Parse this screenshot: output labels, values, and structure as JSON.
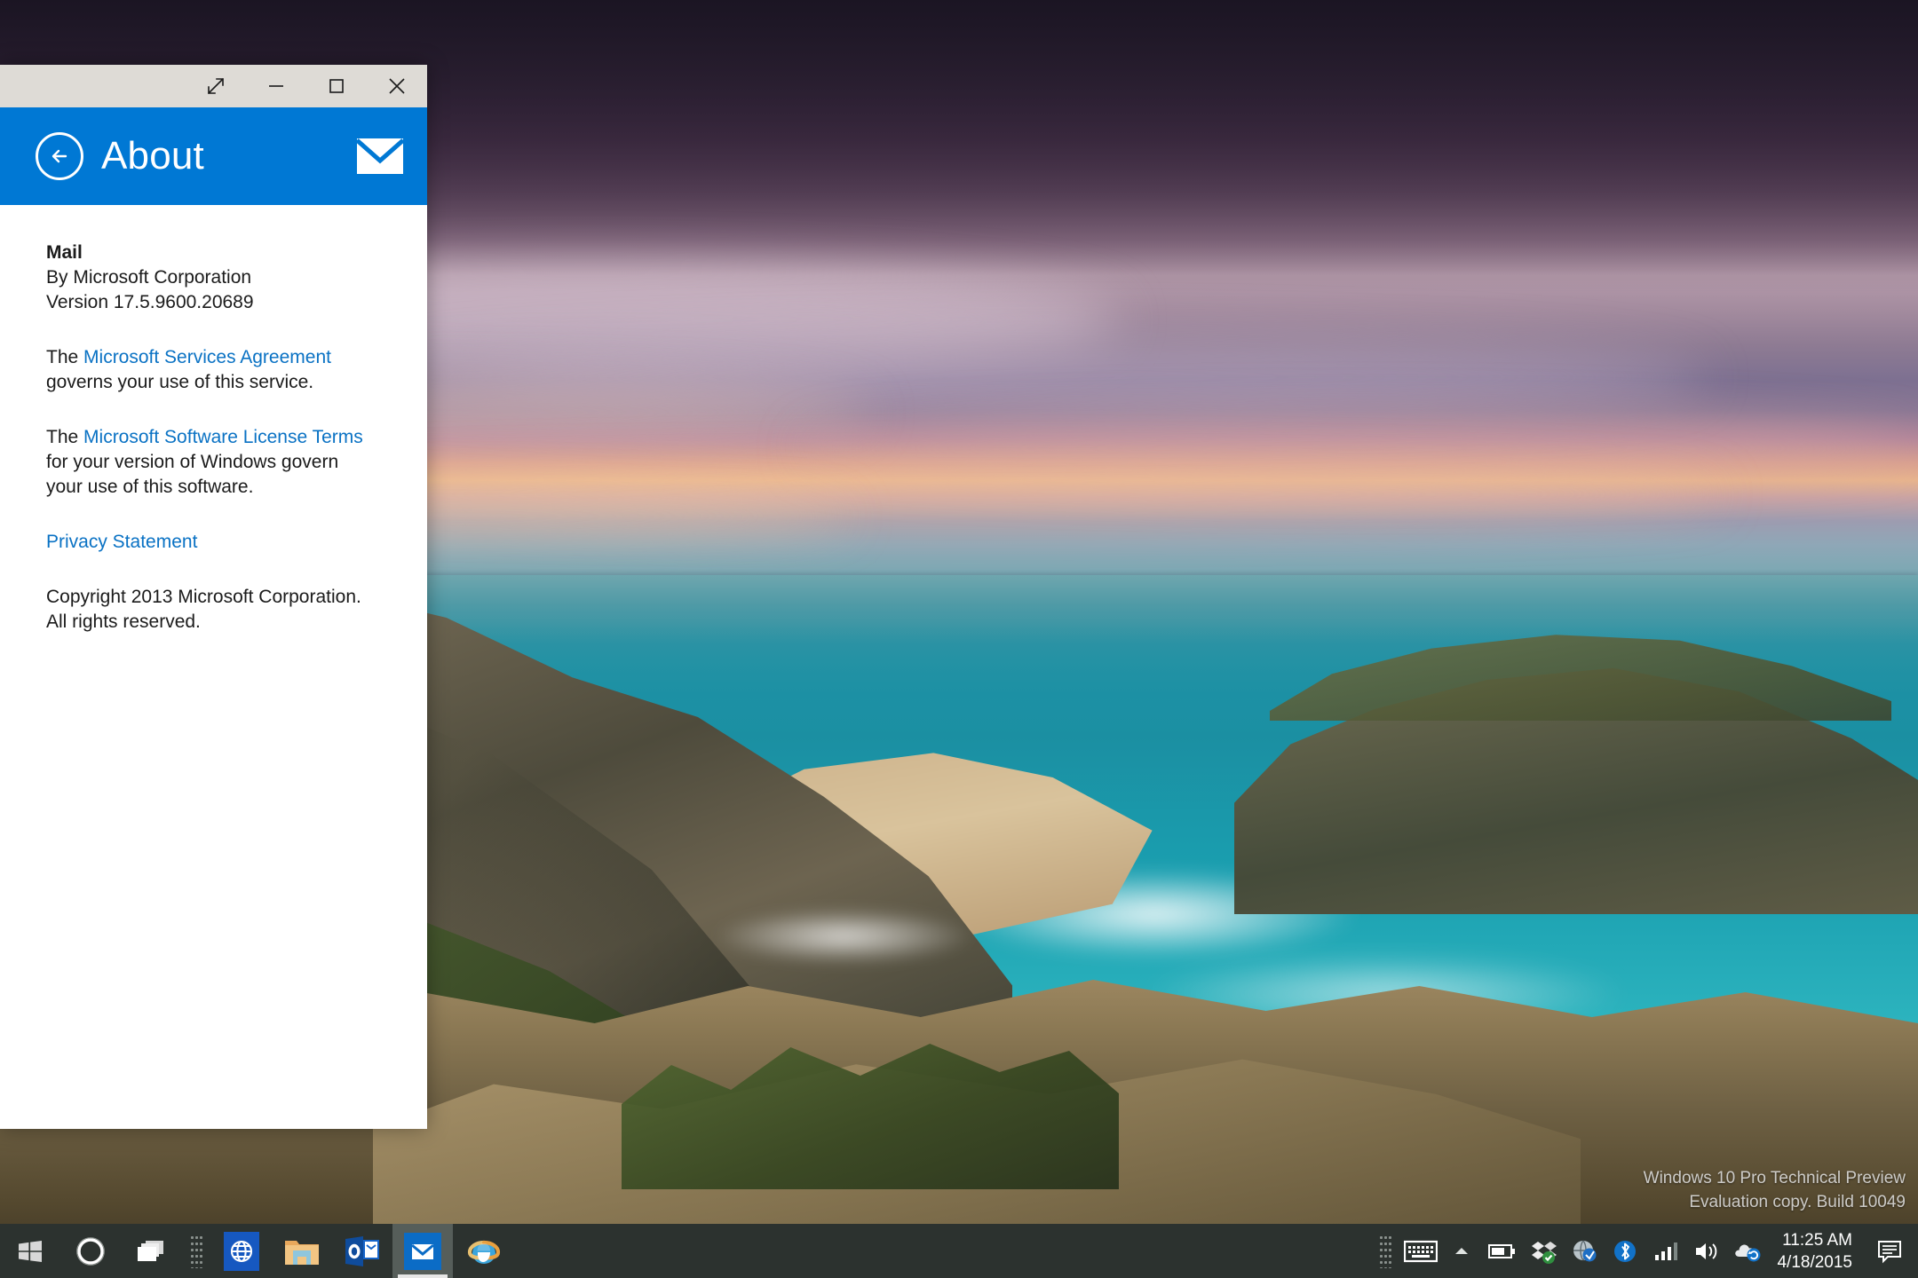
{
  "desktop": {
    "watermark": {
      "line1": "Windows 10 Pro Technical Preview",
      "line2": "Evaluation copy. Build 10049"
    },
    "wallpaper_name": "coastal-sunset-wallpaper"
  },
  "window": {
    "titlebar": {
      "restore_label": "Restore",
      "minimize_label": "Minimize",
      "maximize_label": "Maximize",
      "close_label": "Close"
    },
    "header": {
      "back_label": "Back",
      "title": "About",
      "app_icon": "mail-envelope-icon"
    },
    "about": {
      "app_name": "Mail",
      "publisher": "By Microsoft Corporation",
      "version": "Version 17.5.9600.20689",
      "services_prefix": "The ",
      "services_link": "Microsoft Services Agreement",
      "services_suffix": "governs your use of this service.",
      "license_prefix": "The ",
      "license_link": "Microsoft Software License Terms",
      "license_line2": "for your version of Windows govern",
      "license_line3": "your use of this software.",
      "privacy_link": "Privacy Statement",
      "copyright_line1": "Copyright 2013 Microsoft Corporation.",
      "copyright_line2": "All rights reserved."
    }
  },
  "taskbar": {
    "items": [
      {
        "name": "start-button",
        "icon": "windows-logo-icon",
        "label": "Start",
        "active": false
      },
      {
        "name": "cortana-button",
        "icon": "cortana-circle-icon",
        "label": "Search the web and Windows",
        "active": false
      },
      {
        "name": "task-view-button",
        "icon": "task-view-icon",
        "label": "Task View",
        "active": false
      },
      {
        "name": "store-button",
        "icon": "globe-tile-icon",
        "label": "Store",
        "active": false
      },
      {
        "name": "file-explorer-button",
        "icon": "folder-icon",
        "label": "File Explorer",
        "active": false
      },
      {
        "name": "outlook-button",
        "icon": "outlook-icon",
        "label": "Outlook",
        "active": false
      },
      {
        "name": "mail-button",
        "icon": "mail-envelope-icon",
        "label": "Mail",
        "active": true
      },
      {
        "name": "internet-explorer-button",
        "icon": "internet-explorer-icon",
        "label": "Internet Explorer",
        "active": false
      }
    ],
    "tray": [
      {
        "name": "touch-keyboard-button",
        "icon": "keyboard-icon",
        "label": "Touch keyboard"
      },
      {
        "name": "show-hidden-icons-button",
        "icon": "chevron-up-icon",
        "label": "Show hidden icons"
      },
      {
        "name": "battery-icon",
        "icon": "battery-icon",
        "label": "Battery"
      },
      {
        "name": "dropbox-icon",
        "icon": "dropbox-icon",
        "label": "Dropbox"
      },
      {
        "name": "network-icon",
        "icon": "network-globe-icon",
        "label": "Network"
      },
      {
        "name": "bluetooth-icon",
        "icon": "bluetooth-icon",
        "label": "Bluetooth"
      },
      {
        "name": "signal-icon",
        "icon": "signal-bars-icon",
        "label": "Signal strength"
      },
      {
        "name": "volume-icon",
        "icon": "speaker-icon",
        "label": "Volume"
      },
      {
        "name": "onedrive-icon",
        "icon": "onedrive-sync-icon",
        "label": "OneDrive"
      }
    ],
    "clock": {
      "time": "11:25 AM",
      "date": "4/18/2015"
    },
    "action_center_label": "Action Center"
  },
  "colors": {
    "accent_blue": "#0078d4",
    "link_blue": "#0a72c4",
    "taskbar": "#2c322f",
    "titlebar": "#dedbd6",
    "window_bg": "#ffffff"
  }
}
